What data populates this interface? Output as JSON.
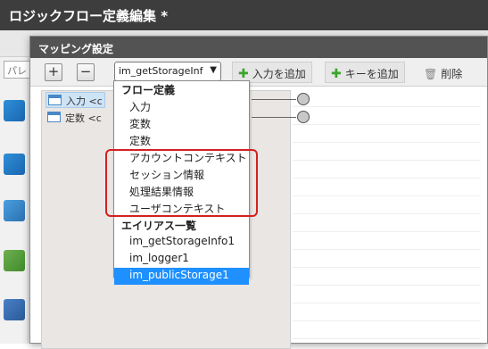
{
  "app": {
    "title": "ロジックフロー定義編集 *"
  },
  "background": {
    "search_placeholder": "パレ"
  },
  "dialog": {
    "title": "マッピング設定",
    "toolbar": {
      "expand_label": "+",
      "collapse_label": "−",
      "select_value": "im_getStorageInf",
      "add_input_label": "入力を追加",
      "add_key_label": "キーを追加",
      "delete_label": "削除"
    },
    "tree": [
      {
        "label": "入力 <c",
        "selected": true
      },
      {
        "label": "定数 <c",
        "selected": false
      }
    ]
  },
  "dropdown": {
    "groups": [
      {
        "header": "フロー定義",
        "items": [
          "入力",
          "変数",
          "定数",
          "アカウントコンテキスト",
          "セッション情報",
          "処理結果情報",
          "ユーザコンテキスト"
        ]
      },
      {
        "header": "エイリアス一覧",
        "items": [
          "im_getStorageInfo1",
          "im_logger1",
          "im_publicStorage1"
        ]
      }
    ],
    "selected": "im_publicStorage1"
  },
  "colors": {
    "selection": "#1e90ff",
    "highlight_border": "#d42020",
    "add_icon": "#3aa52a"
  }
}
